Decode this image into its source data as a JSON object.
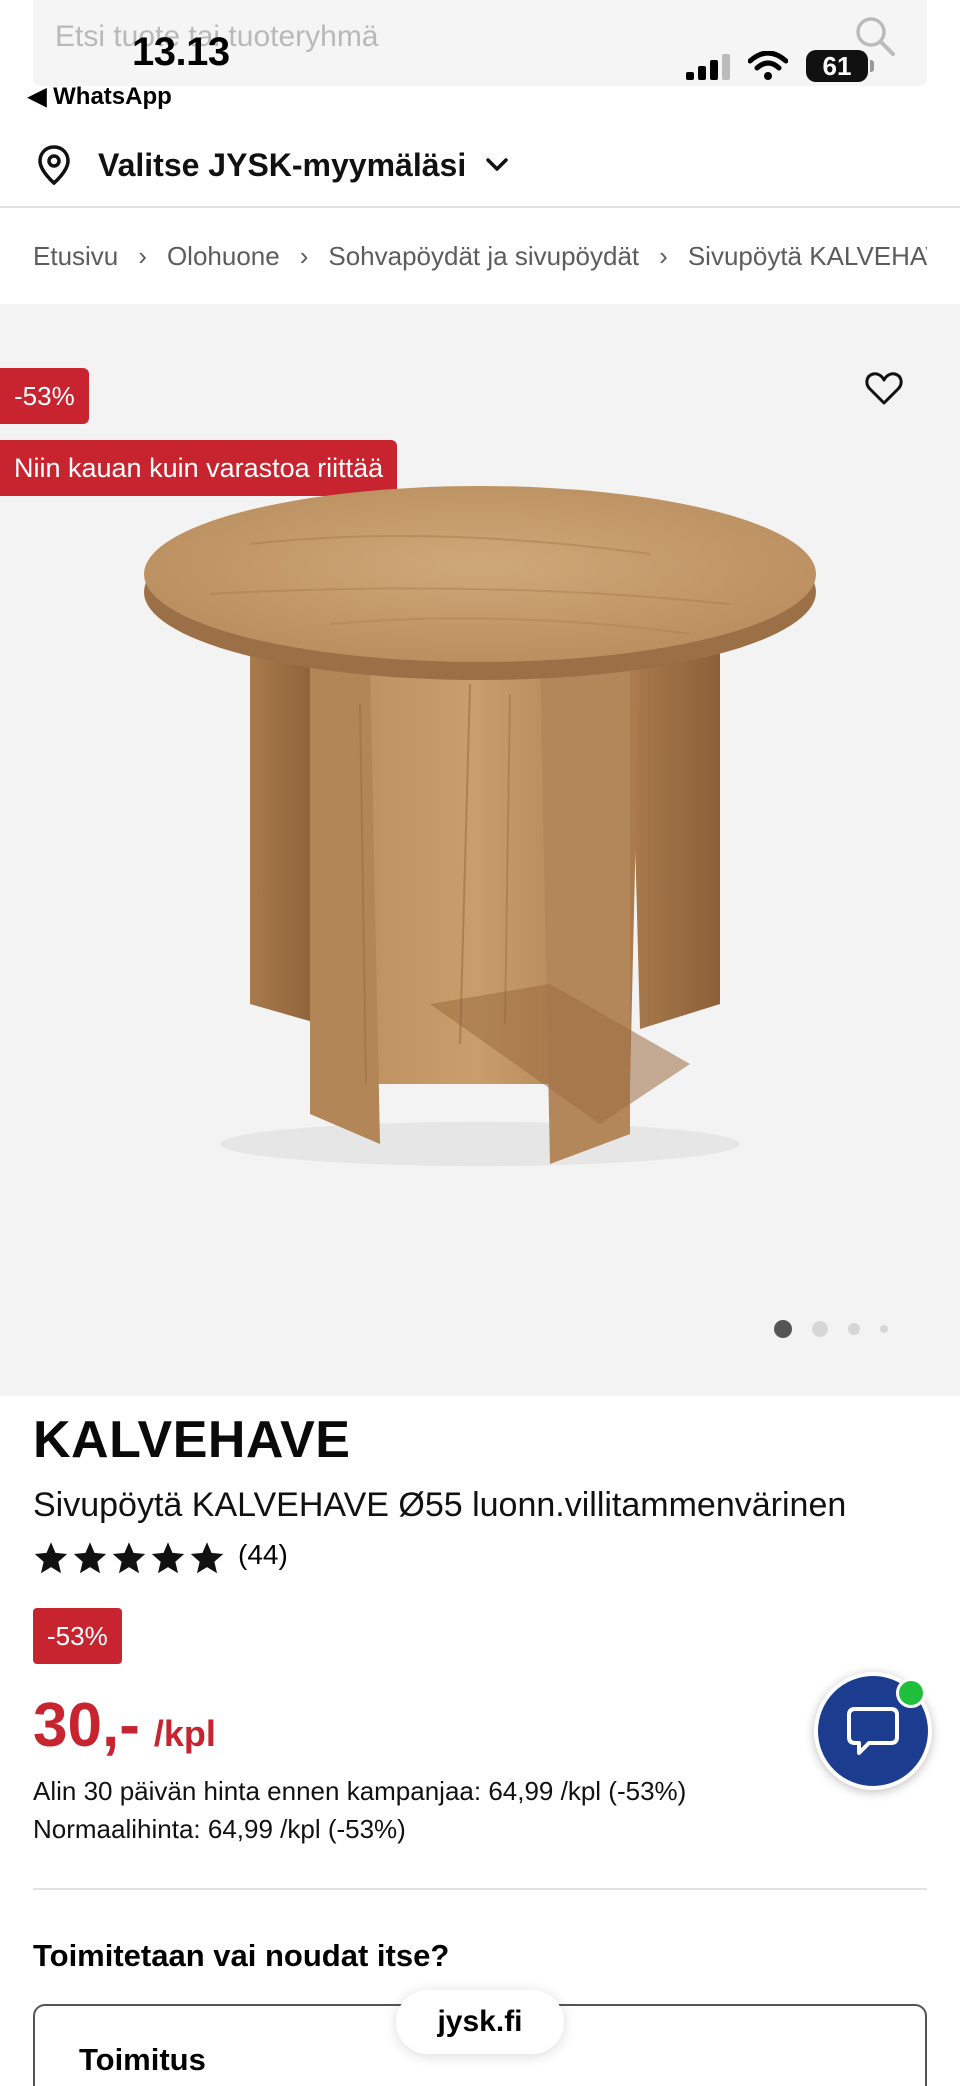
{
  "status_bar": {
    "time": "13.13",
    "back_app": "◀ WhatsApp",
    "battery": "61"
  },
  "search": {
    "placeholder": "Etsi tuote tai tuoteryhmä"
  },
  "store_selector": {
    "label": "Valitse JYSK-myymäläsi"
  },
  "breadcrumb": [
    "Etusivu",
    "Olohuone",
    "Sohvapöydät ja sivupöydät",
    "Sivupöytä KALVEHAVE"
  ],
  "hero": {
    "discount_badge": "-53%",
    "stock_badge": "Niin kauan kuin varastoa riittää",
    "image_count": 4,
    "active_image": 1
  },
  "product": {
    "brand": "KALVEHAVE",
    "name": "Sivupöytä KALVEHAVE Ø55 luonn.villitammenvärinen",
    "rating": 5,
    "review_count": "(44)",
    "discount": "-53%",
    "price": "30,-",
    "unit": "/kpl",
    "lowest_30_days": "Alin 30 päivän hinta ennen kampanjaa: 64,99 /kpl (-53%)",
    "normal_price": "Normaalihinta: 64,99 /kpl (-53%)"
  },
  "delivery": {
    "question": "Toimitetaan vai noudat itse?",
    "option_title": "Toimitus"
  },
  "browser": {
    "url": "jysk.fi"
  },
  "colors": {
    "accent_red": "#c8242f",
    "chat_blue": "#1c3d8f",
    "online_green": "#1fbf3b"
  }
}
